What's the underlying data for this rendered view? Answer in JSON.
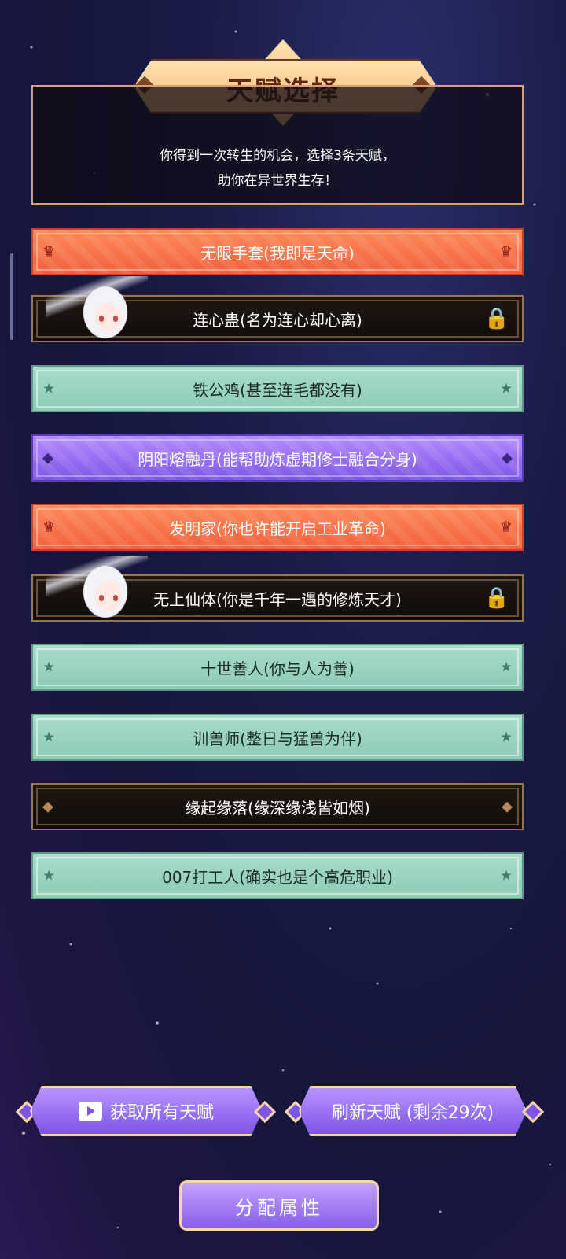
{
  "header": {
    "title": "天赋选择",
    "intro": "你得到一次转生的机会，选择3条天赋，\n助你在异世界生存！"
  },
  "talents": [
    {
      "label": "无限手套(我即是天命)",
      "style": "red",
      "icon": "crown-icon"
    },
    {
      "label": "连心蛊(名为连心却心离)",
      "style": "dark-locked",
      "icon": "lock-icon"
    },
    {
      "label": "铁公鸡(甚至连毛都没有)",
      "style": "teal",
      "icon": "star-icon"
    },
    {
      "label": "阴阳熔融丹(能帮助炼虚期修士融合分身)",
      "style": "purple",
      "icon": "diamond-icon"
    },
    {
      "label": "发明家(你也许能开启工业革命)",
      "style": "red",
      "icon": "crown-icon"
    },
    {
      "label": "无上仙体(你是千年一遇的修炼天才)",
      "style": "dark-locked",
      "icon": "lock-icon"
    },
    {
      "label": "十世善人(你与人为善)",
      "style": "teal",
      "icon": "star-icon"
    },
    {
      "label": "训兽师(整日与猛兽为伴)",
      "style": "teal",
      "icon": "star-icon"
    },
    {
      "label": "缘起缘落(缘深缘浅皆如烟)",
      "style": "dark",
      "icon": "diamond-icon"
    },
    {
      "label": "007打工人(确实也是个高危职业)",
      "style": "teal",
      "icon": "star-icon"
    }
  ],
  "actions": {
    "get_all_label": "获取所有天赋",
    "refresh_label": "刷新天赋 (剩余29次)",
    "assign_label": "分配属性"
  },
  "colors": {
    "red": "#f0603a",
    "teal": "#8fcab7",
    "purple": "#7c56e4",
    "dark": "#120d0a",
    "gold_border": "#d5a07a"
  }
}
